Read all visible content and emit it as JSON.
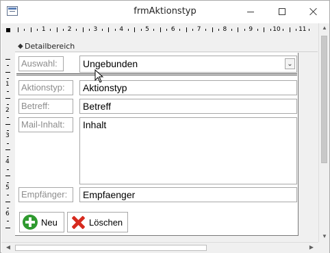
{
  "window": {
    "title": "frmAktionstyp"
  },
  "ruler": {
    "numbers": [
      "1",
      "2",
      "3",
      "4",
      "5",
      "6",
      "7",
      "8",
      "9",
      "10",
      "11"
    ],
    "v_numbers": [
      "1",
      "2",
      "3",
      "4",
      "5",
      "6"
    ]
  },
  "section": {
    "label": "Detailbereich"
  },
  "form": {
    "auswahl_label": "Auswahl:",
    "auswahl_value": "Ungebunden",
    "aktionstyp_label": "Aktionstyp:",
    "aktionstyp_value": "Aktionstyp",
    "betreff_label": "Betreff:",
    "betreff_value": "Betreff",
    "inhalt_label": "Mail-Inhalt:",
    "inhalt_value": "Inhalt",
    "empfaenger_label": "Empfänger:",
    "empfaenger_value": "Empfaenger"
  },
  "buttons": {
    "new_label": "Neu",
    "delete_label": "Löschen"
  },
  "icons": {
    "app": "form-icon",
    "new": "plus-circle-icon",
    "delete": "red-x-icon"
  },
  "colors": {
    "label_text": "#8c8c8c",
    "new_icon": "#2f9a2f",
    "delete_icon": "#d62a1e"
  }
}
